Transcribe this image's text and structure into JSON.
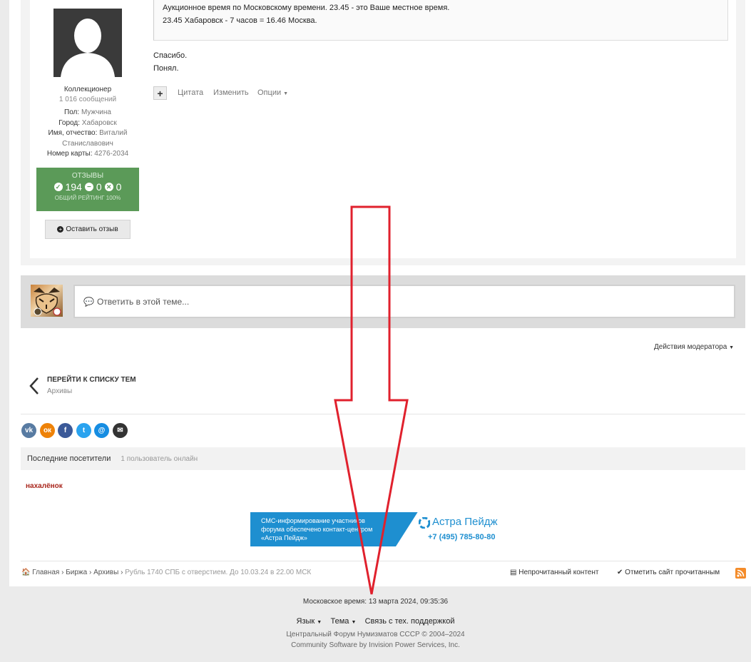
{
  "post": {
    "quote_line1": "Аукционное время по Московскому времени.  23.45 - это Ваше местное время.",
    "quote_line2": "23.45 Хабаровск - 7 часов = 16.46 Москва.",
    "text_line1": "Спасибо.",
    "text_line2": "Понял.",
    "actions": {
      "plus": "+",
      "quote": "Цитата",
      "edit": "Изменить",
      "options": "Опции"
    }
  },
  "author": {
    "rank": "Коллекционер",
    "posts": "1 016 сообщений",
    "fields": [
      {
        "label": "Пол:",
        "value": "Мужчина"
      },
      {
        "label": "Город:",
        "value": "Хабаровск"
      },
      {
        "label": "Имя, отчество:",
        "value": "Виталий"
      },
      {
        "label": "",
        "value": "Станиславович"
      },
      {
        "label": "Номер карты:",
        "value": "4276-2034"
      }
    ],
    "reviews": {
      "title": "ОТЗЫВЫ",
      "positive": "194",
      "neutral": "0",
      "negative": "0",
      "overall": "ОБЩИЙ РЕЙТИНГ 100%"
    },
    "leave_review": "Оставить отзыв"
  },
  "reply": {
    "placeholder": "Ответить в этой теме..."
  },
  "moderator_actions": "Действия модератора",
  "back": {
    "title": "ПЕРЕЙТИ К СПИСКУ ТЕМ",
    "subtitle": "Архивы"
  },
  "share": {
    "vk": "vk",
    "ok": "ок",
    "fb": "f",
    "tw": "t",
    "mail": "@",
    "email": "✉",
    "colors": {
      "vk": "#587ba2",
      "ok": "#ee8208",
      "fb": "#3b5998",
      "tw": "#2aa3ef",
      "mail": "#168de2",
      "email": "#333333"
    }
  },
  "visitors": {
    "title": "Последние посетители",
    "count": "1 пользователь онлайн",
    "user": "нахалёнок"
  },
  "banner": {
    "line1": "СМС-информирование участников",
    "line2": "форума обеспечено контакт-центром",
    "line3": "«Астра Пейдж»",
    "brand": "Астра Пейдж",
    "phone": "+7 (495) 785-80-80"
  },
  "breadcrumb": {
    "home": "Главная",
    "items": [
      "Биржа",
      "Архивы"
    ],
    "current": "Рубль 1740 СПБ с отверстием. До 10.03.24 в 22.00 МСК"
  },
  "footer_links": {
    "unread": "Непрочитанный контент",
    "mark_read": "Отметить сайт прочитанным"
  },
  "footer": {
    "time": "Московское время: 13 марта 2024, 09:35:36",
    "language": "Язык",
    "theme": "Тема",
    "support": "Связь с тех. поддержкой",
    "copyright": "Центральный Форум Нумизматов СССР © 2004–2024",
    "software": "Community Software by Invision Power Services, Inc."
  }
}
